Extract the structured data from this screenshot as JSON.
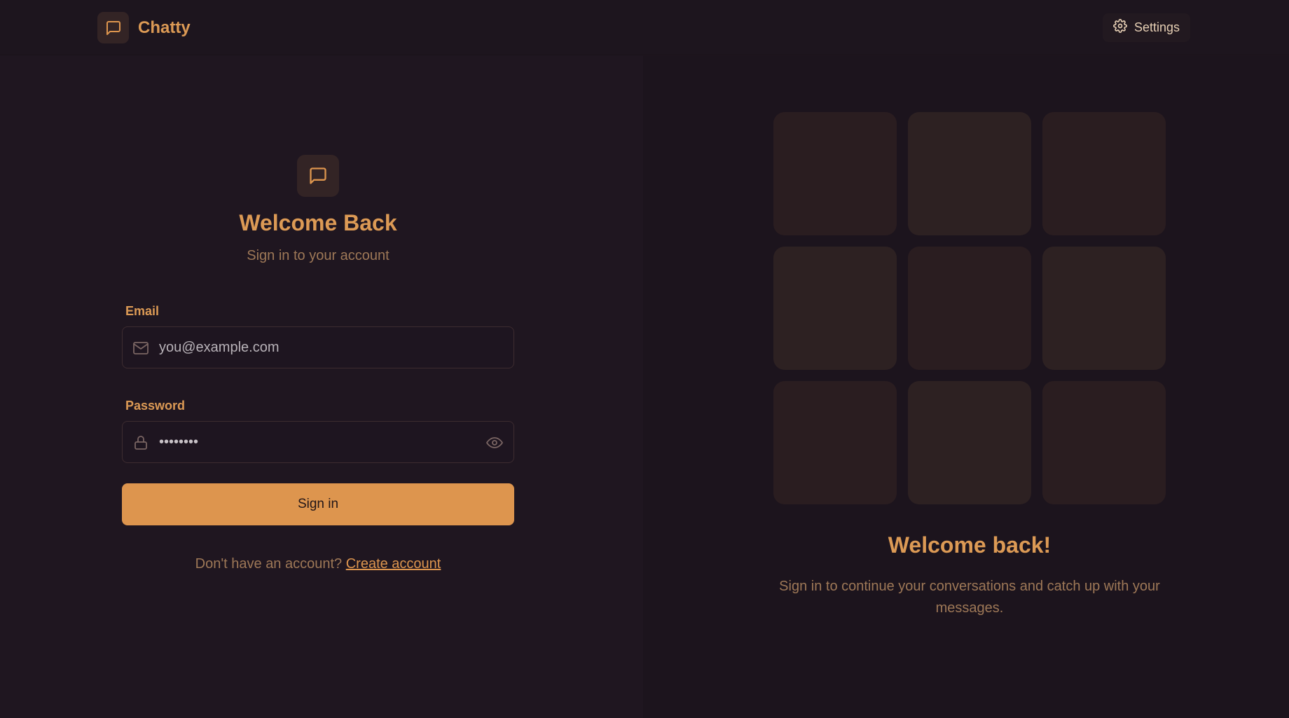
{
  "header": {
    "app_name": "Chatty",
    "settings_label": "Settings"
  },
  "login": {
    "title": "Welcome Back",
    "subtitle": "Sign in to your account",
    "email_label": "Email",
    "email_placeholder": "you@example.com",
    "password_label": "Password",
    "password_value": "••••••••",
    "submit_label": "Sign in",
    "no_account_text": "Don't have an account? ",
    "create_account_label": "Create account"
  },
  "promo": {
    "title": "Welcome back!",
    "text": "Sign in to continue your conversations and catch up with your messages."
  },
  "colors": {
    "accent": "#dd954e",
    "background": "#1f1620",
    "muted_text": "#9e7857"
  },
  "icons": {
    "logo": "chat-bubble-icon",
    "settings": "gear-icon",
    "email": "mail-icon",
    "password": "lock-icon",
    "toggle_password": "eye-icon"
  }
}
